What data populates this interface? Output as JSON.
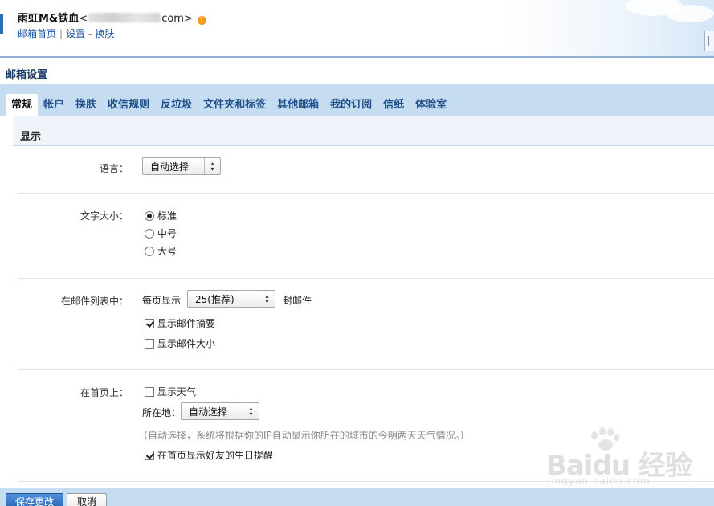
{
  "header": {
    "user_name": "雨虹M&铁血",
    "email_prefix": "<",
    "email_suffix": "com>",
    "warning_mark": "!",
    "links": [
      "邮箱首页",
      "设置",
      "换肤"
    ],
    "separators": [
      "|",
      "-"
    ]
  },
  "page_title": "邮箱设置",
  "tabs": [
    {
      "label": "常规",
      "active": true
    },
    {
      "label": "帐户"
    },
    {
      "label": "换肤"
    },
    {
      "label": "收信规则"
    },
    {
      "label": "反垃圾"
    },
    {
      "label": "文件夹和标签"
    },
    {
      "label": "其他邮箱"
    },
    {
      "label": "我的订阅"
    },
    {
      "label": "信纸"
    },
    {
      "label": "体验室"
    }
  ],
  "section_title": "显示",
  "language": {
    "label": "语言：",
    "value": "自动选择"
  },
  "font_size": {
    "label": "文字大小：",
    "options": [
      "标准",
      "中号",
      "大号"
    ],
    "selected": "标准"
  },
  "mail_list": {
    "label": "在邮件列表中：",
    "per_page_prefix": "每页显示",
    "per_page_value": "25(推荐)",
    "per_page_suffix": "封邮件",
    "show_summary": {
      "label": "显示邮件摘要",
      "checked": true
    },
    "show_size": {
      "label": "显示邮件大小",
      "checked": false
    }
  },
  "homepage": {
    "label": "在首页上：",
    "show_weather": {
      "label": "显示天气",
      "checked": false
    },
    "location_label": "所在地：",
    "location_value": "自动选择",
    "location_hint": "（自动选择，系统将根据你的IP自动显示你所在的城市的今明两天天气情况。）",
    "birthday_reminder": {
      "label": "在首页显示好友的生日提醒",
      "checked": true
    }
  },
  "buttons": {
    "save": "保存更改",
    "cancel": "取消"
  },
  "watermark": {
    "logo_text": "Baidu 经验",
    "url": "jingyan.baidu.com"
  },
  "colors": {
    "tab_bar": "#c6dcf1",
    "link": "#1d54a6",
    "primary_button": "#2a67b5"
  }
}
